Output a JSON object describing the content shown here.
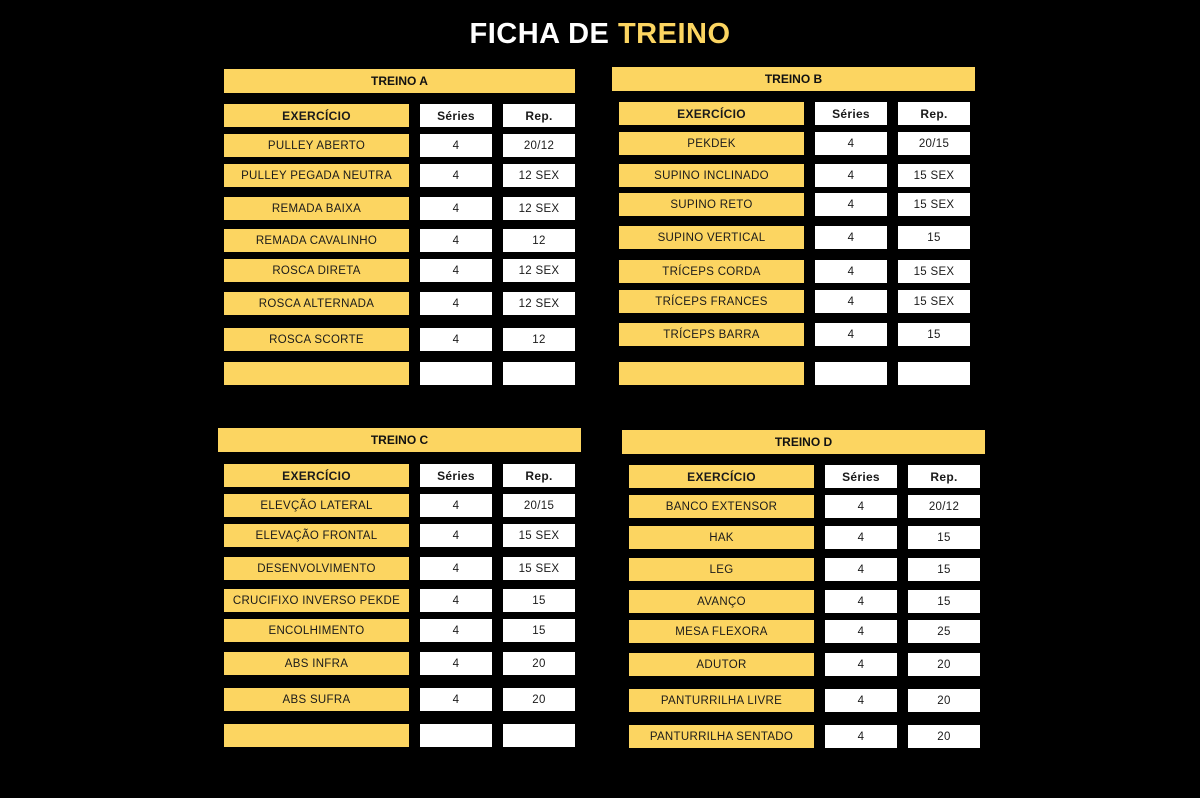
{
  "title": {
    "main": "FICHA DE",
    "accent": "TREINO"
  },
  "colors": {
    "background": "#000000",
    "accent": "#fcd561",
    "cell": "#ffffff"
  },
  "headers": {
    "exercise": "EXERCÍCIO",
    "series": "Séries",
    "reps": "Rep."
  },
  "blocks": [
    {
      "title": "TREINO A",
      "rows": [
        {
          "exercise": "PULLEY ABERTO",
          "series": "4",
          "reps": "20/12"
        },
        {
          "exercise": "PULLEY PEGADA NEUTRA",
          "series": "4",
          "reps": "12 SEX"
        },
        {
          "exercise": "REMADA BAIXA",
          "series": "4",
          "reps": "12 SEX"
        },
        {
          "exercise": "REMADA CAVALINHO",
          "series": "4",
          "reps": "12"
        },
        {
          "exercise": "ROSCA DIRETA",
          "series": "4",
          "reps": "12 SEX"
        },
        {
          "exercise": "ROSCA ALTERNADA",
          "series": "4",
          "reps": "12 SEX"
        },
        {
          "exercise": "ROSCA SCORTE",
          "series": "4",
          "reps": "12"
        },
        {
          "exercise": "",
          "series": "",
          "reps": ""
        }
      ]
    },
    {
      "title": "TREINO B",
      "rows": [
        {
          "exercise": "PEKDEK",
          "series": "4",
          "reps": "20/15"
        },
        {
          "exercise": "SUPINO INCLINADO",
          "series": "4",
          "reps": "15 SEX"
        },
        {
          "exercise": "SUPINO RETO",
          "series": "4",
          "reps": "15 SEX"
        },
        {
          "exercise": "SUPINO VERTICAL",
          "series": "4",
          "reps": "15"
        },
        {
          "exercise": "TRÍCEPS CORDA",
          "series": "4",
          "reps": "15 SEX"
        },
        {
          "exercise": "TRÍCEPS FRANCES",
          "series": "4",
          "reps": "15 SEX"
        },
        {
          "exercise": "TRÍCEPS BARRA",
          "series": "4",
          "reps": "15"
        },
        {
          "exercise": "",
          "series": "",
          "reps": ""
        }
      ]
    },
    {
      "title": "TREINO C",
      "rows": [
        {
          "exercise": "ELEVÇÃO  LATERAL",
          "series": "4",
          "reps": "20/15"
        },
        {
          "exercise": "ELEVAÇÃO FRONTAL",
          "series": "4",
          "reps": "15 SEX"
        },
        {
          "exercise": "DESENVOLVIMENTO",
          "series": "4",
          "reps": "15 SEX"
        },
        {
          "exercise": "CRUCIFIXO INVERSO PEKDE",
          "series": "4",
          "reps": "15"
        },
        {
          "exercise": "ENCOLHIMENTO",
          "series": "4",
          "reps": "15"
        },
        {
          "exercise": "ABS INFRA",
          "series": "4",
          "reps": "20"
        },
        {
          "exercise": "ABS SUFRA",
          "series": "4",
          "reps": "20"
        },
        {
          "exercise": "",
          "series": "",
          "reps": ""
        }
      ]
    },
    {
      "title": "TREINO D",
      "rows": [
        {
          "exercise": "BANCO EXTENSOR",
          "series": "4",
          "reps": "20/12"
        },
        {
          "exercise": "HAK",
          "series": "4",
          "reps": "15"
        },
        {
          "exercise": "LEG",
          "series": "4",
          "reps": "15"
        },
        {
          "exercise": "AVANÇO",
          "series": "4",
          "reps": "15"
        },
        {
          "exercise": "MESA FLEXORA",
          "series": "4",
          "reps": "25"
        },
        {
          "exercise": "ADUTOR",
          "series": "4",
          "reps": "20"
        },
        {
          "exercise": "PANTURRILHA LIVRE",
          "series": "4",
          "reps": "20"
        },
        {
          "exercise": "PANTURRILHA SENTADO",
          "series": "4",
          "reps": "20"
        }
      ]
    }
  ]
}
